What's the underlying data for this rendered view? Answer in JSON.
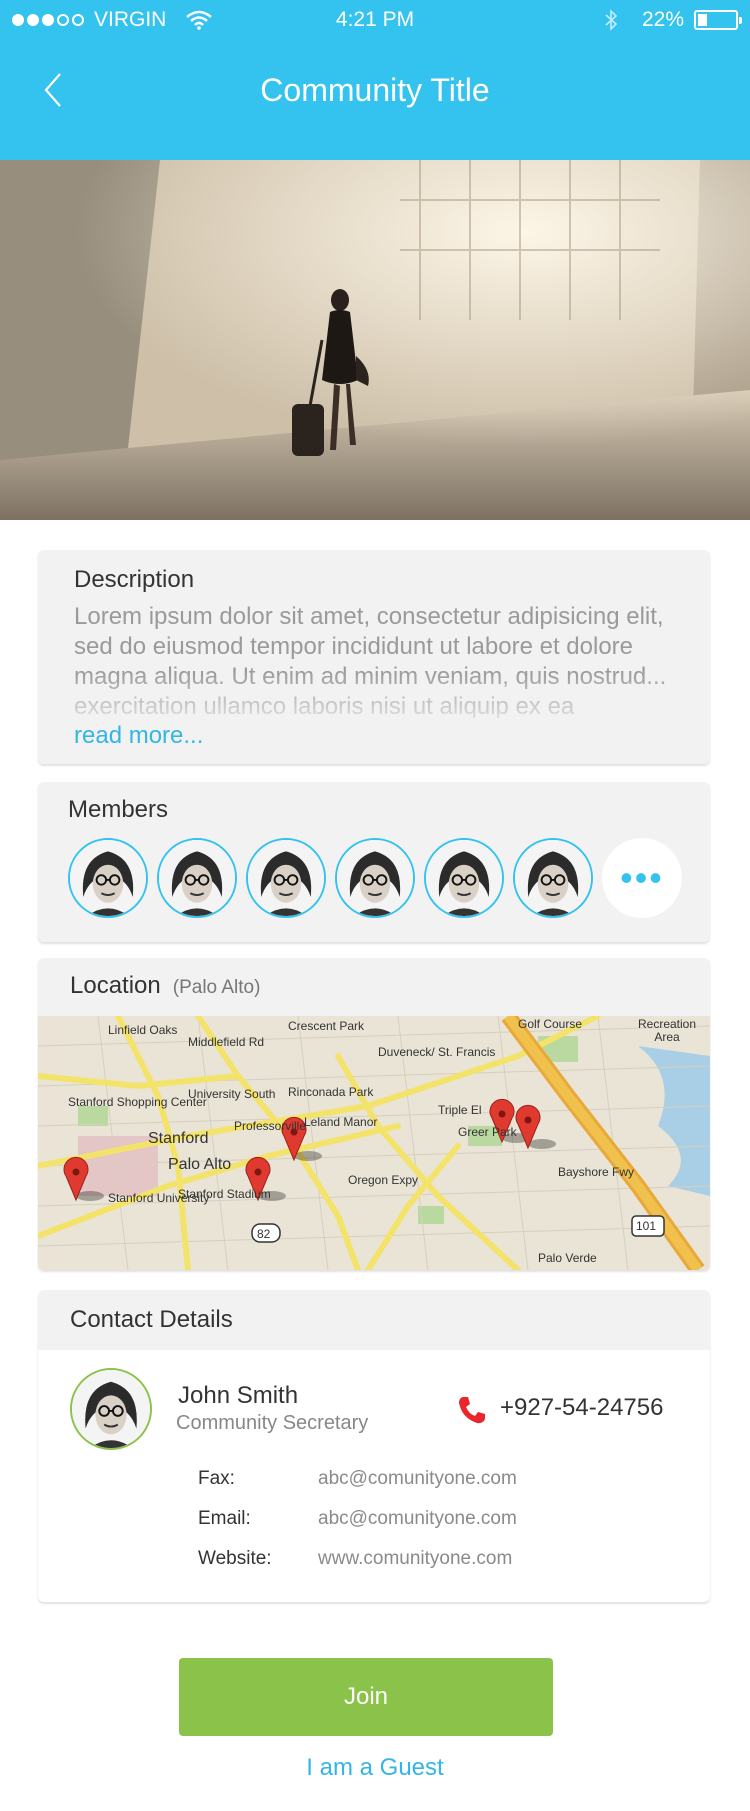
{
  "status_bar": {
    "carrier": "VIRGIN",
    "time": "4:21 PM",
    "battery_text": "22%",
    "battery_level": 0.22,
    "signal_bars_filled": 3,
    "signal_bars_total": 5
  },
  "header": {
    "title": "Community Title",
    "back_icon": "chevron-left-icon",
    "color": "#33c3ee"
  },
  "description": {
    "title": "Description",
    "text": "Lorem ipsum dolor sit amet, consectetur adipisicing elit, sed do eiusmod tempor incididunt ut labore et dolore magna aliqua. Ut enim ad minim veniam, quis nostrud... exercitation ullamco laboris nisi ut aliquip ex ea",
    "read_more": "read more..."
  },
  "members": {
    "title": "Members",
    "count_shown": 6,
    "more_label": "•••"
  },
  "location": {
    "title": "Location",
    "subtitle": "(Palo Alto)",
    "map_labels": [
      "Linfield Oaks",
      "Crescent Park",
      "Golf Course",
      "Recreation Area",
      "Duveneck/ St. Francis",
      "Middlefield Rd",
      "University South",
      "Rinconada Park",
      "Triple El",
      "Greer Park",
      "Leland Manor",
      "Professorville",
      "Stanford Shopping Center",
      "Stanford",
      "Palo Alto",
      "Stanford University",
      "Stanford Stadium",
      "Oregon Expy",
      "Bayshore Fwy",
      "101",
      "82",
      "Palo Verde"
    ]
  },
  "contact": {
    "title": "Contact Details",
    "name": "John Smith",
    "role": "Community Secretary",
    "phone": "+927-54-24756",
    "fax_label": "Fax:",
    "fax": "abc@comunityone.com",
    "email_label": "Email:",
    "email": "abc@comunityone.com",
    "website_label": "Website:",
    "website": "www.comunityone.com"
  },
  "actions": {
    "join": "Join",
    "guest": "I am a Guest",
    "join_color": "#8bc34a"
  }
}
